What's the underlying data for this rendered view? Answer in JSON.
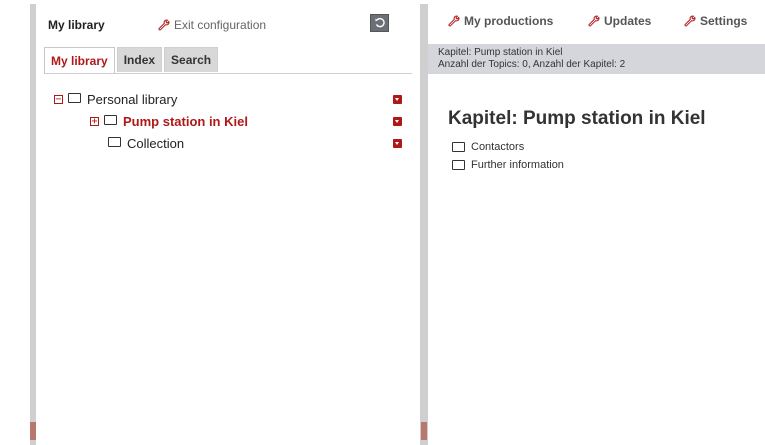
{
  "left": {
    "title": "My library",
    "exit_label": "Exit configuration",
    "tabs": [
      {
        "label": "My library",
        "active": true
      },
      {
        "label": "Index",
        "active": false
      },
      {
        "label": "Search",
        "active": false
      }
    ],
    "tree": [
      {
        "label": "Personal library",
        "toggle": "−",
        "selected": false
      },
      {
        "label": "Pump station in Kiel",
        "toggle": "+",
        "selected": true
      },
      {
        "label": "Collection",
        "toggle": "",
        "selected": false
      }
    ]
  },
  "right": {
    "nav": {
      "productions": "My productions",
      "updates": "Updates",
      "settings": "Settings"
    },
    "info_line1": "Kapitel: Pump station in Kiel",
    "info_line2": "Anzahl der Topics: 0, Anzahl der Kapitel: 2",
    "chapter_title": "Kapitel: Pump station in Kiel",
    "subitems": [
      "Contactors",
      "Further information"
    ]
  },
  "colors": {
    "accent_red": "#b01818",
    "frame_gray": "#cfcfcf",
    "info_bar_bg": "#d4d6dc"
  },
  "icons": [
    "wrench-icon",
    "reset-icon",
    "folder-icon",
    "expand-icon",
    "collapse-icon",
    "dropdown-menu-icon",
    "collapse-panel-arrow-icon"
  ]
}
